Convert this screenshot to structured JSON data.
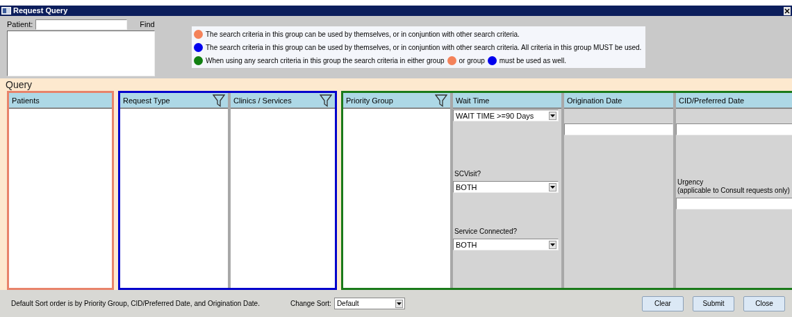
{
  "window": {
    "title": "Request Query"
  },
  "patient": {
    "label": "Patient:",
    "find": "Find"
  },
  "legend": [
    {
      "color": "#f4825a",
      "segments": [
        {
          "kind": "text",
          "text": "The search criteria in this group can be used by themselves, or in conjuntion with other search criteria."
        }
      ]
    },
    {
      "color": "#0000ee",
      "segments": [
        {
          "kind": "text",
          "text": "The search criteria in this group can be used by themselves, or in conjuntion with other search criteria. All criteria in this group MUST be used."
        }
      ]
    },
    {
      "color": "#118011",
      "segments": [
        {
          "kind": "text",
          "text": "When using any search criteria in this group the search criteria in either group"
        },
        {
          "kind": "dot",
          "color": "#f4825a"
        },
        {
          "kind": "text",
          "text": "or group"
        },
        {
          "kind": "dot",
          "color": "#0000ee"
        },
        {
          "kind": "text",
          "text": "must be used as well."
        }
      ]
    }
  ],
  "query": {
    "title": "Query",
    "groups": [
      {
        "color": "#e8836a",
        "columns": [
          {
            "kind": "list",
            "header": "Patients",
            "filter": false
          }
        ]
      },
      {
        "color": "#0000cc",
        "columns": [
          {
            "kind": "list",
            "header": "Request Type",
            "filter": true
          },
          {
            "kind": "list",
            "header": "Clinics / Services",
            "filter": true
          }
        ]
      },
      {
        "color": "#1a7a1a",
        "columns": [
          {
            "kind": "list",
            "header": "Priority Group",
            "filter": true
          },
          {
            "kind": "fields",
            "header": "Wait Time",
            "fields": [
              {
                "kind": "combo",
                "value": "WAIT TIME >=90 Days"
              },
              {
                "kind": "combo",
                "label": "SCVisit?",
                "value": "BOTH"
              },
              {
                "kind": "combo",
                "label": "Service Connected?",
                "value": "BOTH"
              }
            ]
          },
          {
            "kind": "fields",
            "header": "Origination Date",
            "fields": [
              {
                "kind": "text"
              }
            ]
          },
          {
            "kind": "fields",
            "header": "CID/Preferred Date",
            "fields": [
              {
                "kind": "text"
              },
              {
                "kind": "text",
                "label": "Urgency\n(applicable to Consult requests only)"
              }
            ]
          }
        ]
      }
    ]
  },
  "footer": {
    "note": "Default Sort order is by Priority Group, CID/Preferred Date, and Origination Date.",
    "sort_label": "Change Sort:",
    "sort_value": "Default",
    "buttons": [
      "Clear",
      "Submit",
      "Close"
    ]
  }
}
